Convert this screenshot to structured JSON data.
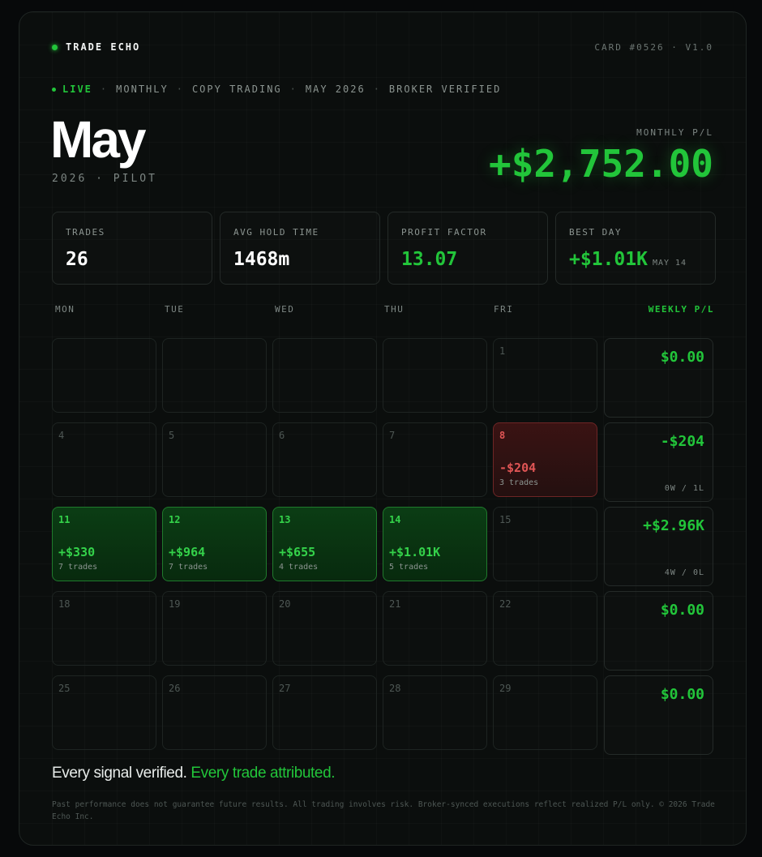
{
  "header": {
    "brand": "TRADE ECHO",
    "card_id": "CARD #0526 · V1.0"
  },
  "tags": {
    "live": "LIVE",
    "items": [
      "MONTHLY",
      "COPY TRADING",
      "MAY 2026",
      "BROKER VERIFIED"
    ],
    "separator": "·"
  },
  "title": {
    "month": "May",
    "subtitle": "2026 · PILOT"
  },
  "monthly_pl": {
    "label": "MONTHLY P/L",
    "value": "+$2,752.00"
  },
  "stats": [
    {
      "label": "TRADES",
      "value": "26",
      "sub": "",
      "accent": false
    },
    {
      "label": "AVG HOLD TIME",
      "value": "1468m",
      "sub": "",
      "accent": false
    },
    {
      "label": "PROFIT FACTOR",
      "value": "13.07",
      "sub": "",
      "accent": true
    },
    {
      "label": "BEST DAY",
      "value": "+$1.01K",
      "sub": "MAY 14",
      "accent": true
    }
  ],
  "calendar": {
    "weekdays": [
      "MON",
      "TUE",
      "WED",
      "THU",
      "FRI"
    ],
    "weekly_header": "WEEKLY P/L",
    "weeks": [
      {
        "days": [
          {
            "num": "",
            "pl": "",
            "trades": "",
            "status": "empty"
          },
          {
            "num": "",
            "pl": "",
            "trades": "",
            "status": "empty"
          },
          {
            "num": "",
            "pl": "",
            "trades": "",
            "status": "empty"
          },
          {
            "num": "",
            "pl": "",
            "trades": "",
            "status": "empty"
          },
          {
            "num": "1",
            "pl": "",
            "trades": "",
            "status": "none"
          }
        ],
        "weekly_pl": "$0.00",
        "record": ""
      },
      {
        "days": [
          {
            "num": "4",
            "pl": "",
            "trades": "",
            "status": "none"
          },
          {
            "num": "5",
            "pl": "",
            "trades": "",
            "status": "none"
          },
          {
            "num": "6",
            "pl": "",
            "trades": "",
            "status": "none"
          },
          {
            "num": "7",
            "pl": "",
            "trades": "",
            "status": "none"
          },
          {
            "num": "8",
            "pl": "-$204",
            "trades": "3 trades",
            "status": "loss"
          }
        ],
        "weekly_pl": "-$204",
        "record": "0W / 1L"
      },
      {
        "days": [
          {
            "num": "11",
            "pl": "+$330",
            "trades": "7 trades",
            "status": "win"
          },
          {
            "num": "12",
            "pl": "+$964",
            "trades": "7 trades",
            "status": "win"
          },
          {
            "num": "13",
            "pl": "+$655",
            "trades": "4 trades",
            "status": "win"
          },
          {
            "num": "14",
            "pl": "+$1.01K",
            "trades": "5 trades",
            "status": "win"
          },
          {
            "num": "15",
            "pl": "",
            "trades": "",
            "status": "none"
          }
        ],
        "weekly_pl": "+$2.96K",
        "record": "4W / 0L"
      },
      {
        "days": [
          {
            "num": "18",
            "pl": "",
            "trades": "",
            "status": "none"
          },
          {
            "num": "19",
            "pl": "",
            "trades": "",
            "status": "none"
          },
          {
            "num": "20",
            "pl": "",
            "trades": "",
            "status": "none"
          },
          {
            "num": "21",
            "pl": "",
            "trades": "",
            "status": "none"
          },
          {
            "num": "22",
            "pl": "",
            "trades": "",
            "status": "none"
          }
        ],
        "weekly_pl": "$0.00",
        "record": ""
      },
      {
        "days": [
          {
            "num": "25",
            "pl": "",
            "trades": "",
            "status": "none"
          },
          {
            "num": "26",
            "pl": "",
            "trades": "",
            "status": "none"
          },
          {
            "num": "27",
            "pl": "",
            "trades": "",
            "status": "none"
          },
          {
            "num": "28",
            "pl": "",
            "trades": "",
            "status": "none"
          },
          {
            "num": "29",
            "pl": "",
            "trades": "",
            "status": "none"
          }
        ],
        "weekly_pl": "$0.00",
        "record": ""
      }
    ]
  },
  "footer": {
    "statement_white": "Every signal verified.",
    "statement_green": "Every trade attributed.",
    "disclaimer": "Past performance does not guarantee future results. All trading involves risk. Broker-synced executions reflect realized P/L only. © 2026 Trade Echo Inc."
  },
  "colors": {
    "accent_green": "#22c53a",
    "loss_red": "#e05555",
    "background": "#0b0e0d"
  }
}
